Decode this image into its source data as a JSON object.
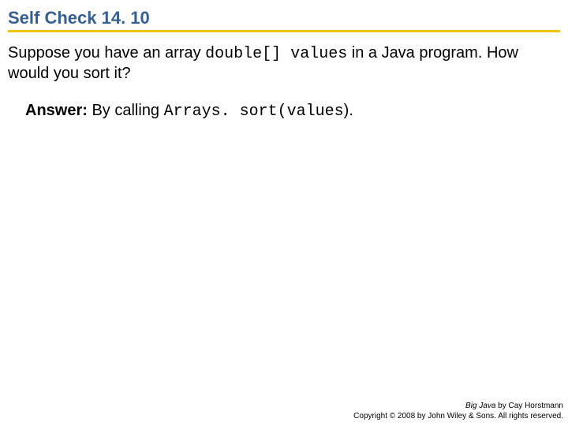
{
  "title": "Self Check 14. 10",
  "question": {
    "pre": "Suppose you have an array ",
    "code": "double[] values",
    "post": " in a Java program. How would you sort it?"
  },
  "answer": {
    "label": "Answer:",
    "pre": " By calling ",
    "code": "Arrays. sort(values",
    "post": ")."
  },
  "footer": {
    "book": "Big Java",
    "byline": " by Cay Horstmann",
    "copyright": "Copyright © 2008 by John Wiley & Sons.  All rights reserved."
  }
}
